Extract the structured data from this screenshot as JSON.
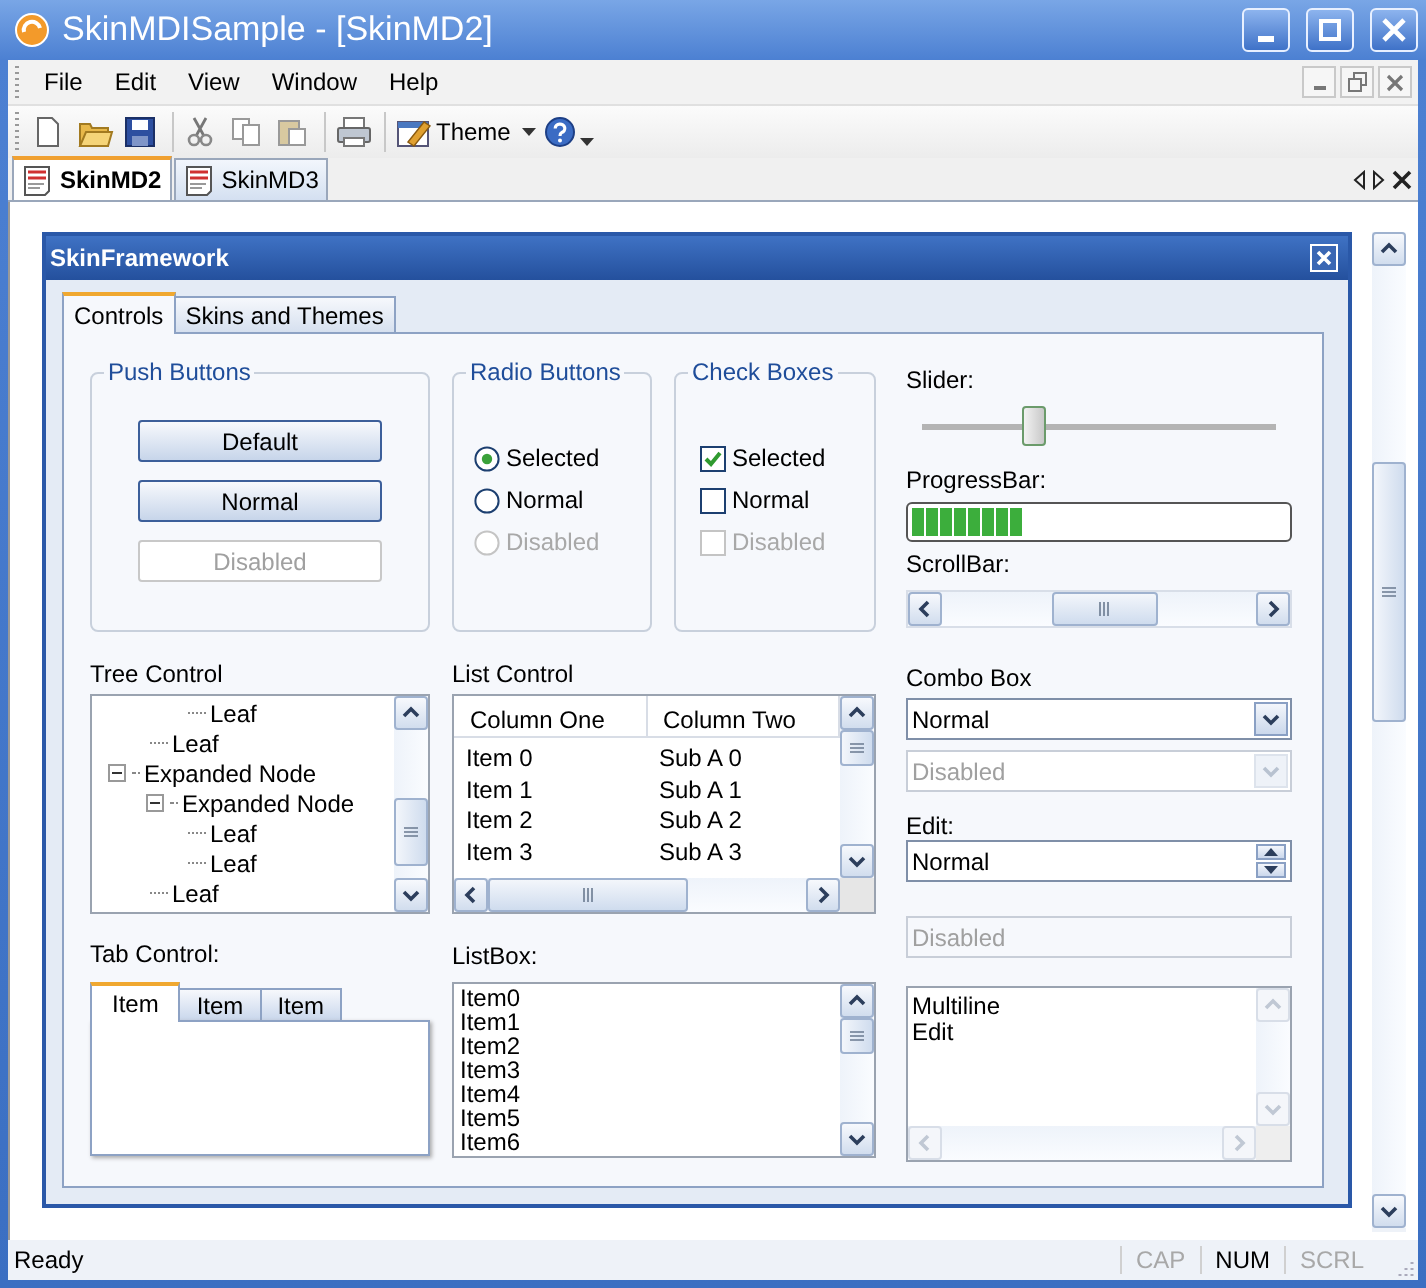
{
  "window": {
    "title": "SkinMDISample - [SkinMD2]"
  },
  "menu": [
    {
      "label": "File"
    },
    {
      "label": "Edit"
    },
    {
      "label": "View"
    },
    {
      "label": "Window"
    },
    {
      "label": "Help"
    }
  ],
  "toolbar": {
    "theme_label": "Theme"
  },
  "doc_tabs": [
    {
      "label": "SkinMD2",
      "selected": true
    },
    {
      "label": "SkinMD3",
      "selected": false
    }
  ],
  "child_window": {
    "title": "SkinFramework",
    "tabs": [
      {
        "label": "Controls",
        "selected": true
      },
      {
        "label": "Skins and Themes",
        "selected": false
      }
    ],
    "push_buttons": {
      "title": "Push Buttons",
      "buttons": [
        {
          "label": "Default",
          "disabled": false
        },
        {
          "label": "Normal",
          "disabled": false
        },
        {
          "label": "Disabled",
          "disabled": true
        }
      ]
    },
    "radio_buttons": {
      "title": "Radio Buttons",
      "items": [
        {
          "label": "Selected",
          "selected": true,
          "disabled": false
        },
        {
          "label": "Normal",
          "selected": false,
          "disabled": false
        },
        {
          "label": "Disabled",
          "selected": false,
          "disabled": true
        }
      ]
    },
    "check_boxes": {
      "title": "Check Boxes",
      "items": [
        {
          "label": "Selected",
          "checked": true,
          "disabled": false
        },
        {
          "label": "Normal",
          "checked": false,
          "disabled": false
        },
        {
          "label": "Disabled",
          "checked": false,
          "disabled": true
        }
      ]
    },
    "slider": {
      "label": "Slider:",
      "level": 0.3
    },
    "progress_bar": {
      "label": "ProgressBar:",
      "level": 0.3
    },
    "scroll_bar": {
      "label": "ScrollBar:"
    },
    "tree_control": {
      "label": "Tree Control",
      "nodes": [
        {
          "children": [
            {
              "children": [
                {
                  "label": "Leaf"
                }
              ]
            },
            {
              "label": "Leaf"
            }
          ]
        },
        {
          "label": "Expanded Node",
          "expanded": true,
          "children": [
            {
              "label": "Expanded Node",
              "expanded": true,
              "children": [
                {
                  "label": "Leaf"
                },
                {
                  "label": "Leaf"
                }
              ]
            },
            {
              "label": "Leaf"
            }
          ]
        }
      ]
    },
    "list_control": {
      "label": "List Control",
      "columns": [
        "Column One",
        "Column Two"
      ],
      "rows": [
        [
          "Item 0",
          "Sub A 0"
        ],
        [
          "Item 1",
          "Sub A 1"
        ],
        [
          "Item 2",
          "Sub A 2"
        ],
        [
          "Item 3",
          "Sub A 3"
        ]
      ]
    },
    "combo_box": {
      "label": "Combo Box",
      "combos": [
        {
          "value": "Normal",
          "disabled": false
        },
        {
          "value": "Disabled",
          "disabled": true
        }
      ]
    },
    "edit": {
      "label": "Edit:",
      "fields": [
        {
          "kind": "spin",
          "value": "Normal",
          "disabled": false
        },
        {
          "kind": "plain",
          "value": "Disabled",
          "disabled": true
        }
      ]
    },
    "tab_control": {
      "label": "Tab Control:",
      "tabs": [
        {
          "label": "Item",
          "selected": true
        },
        {
          "label": "Item",
          "selected": false
        },
        {
          "label": "Item",
          "selected": false
        }
      ]
    },
    "list_box": {
      "label": "ListBox:",
      "items": [
        "Item0",
        "Item1",
        "Item2",
        "Item3",
        "Item4",
        "Item5",
        "Item6"
      ]
    },
    "multiline_edit": {
      "value": "Multiline\nEdit"
    }
  },
  "status_bar": {
    "text": "Ready",
    "indicators": [
      {
        "label": "CAP",
        "on": false
      },
      {
        "label": "NUM",
        "on": true
      },
      {
        "label": "SCRL",
        "on": false
      }
    ]
  }
}
